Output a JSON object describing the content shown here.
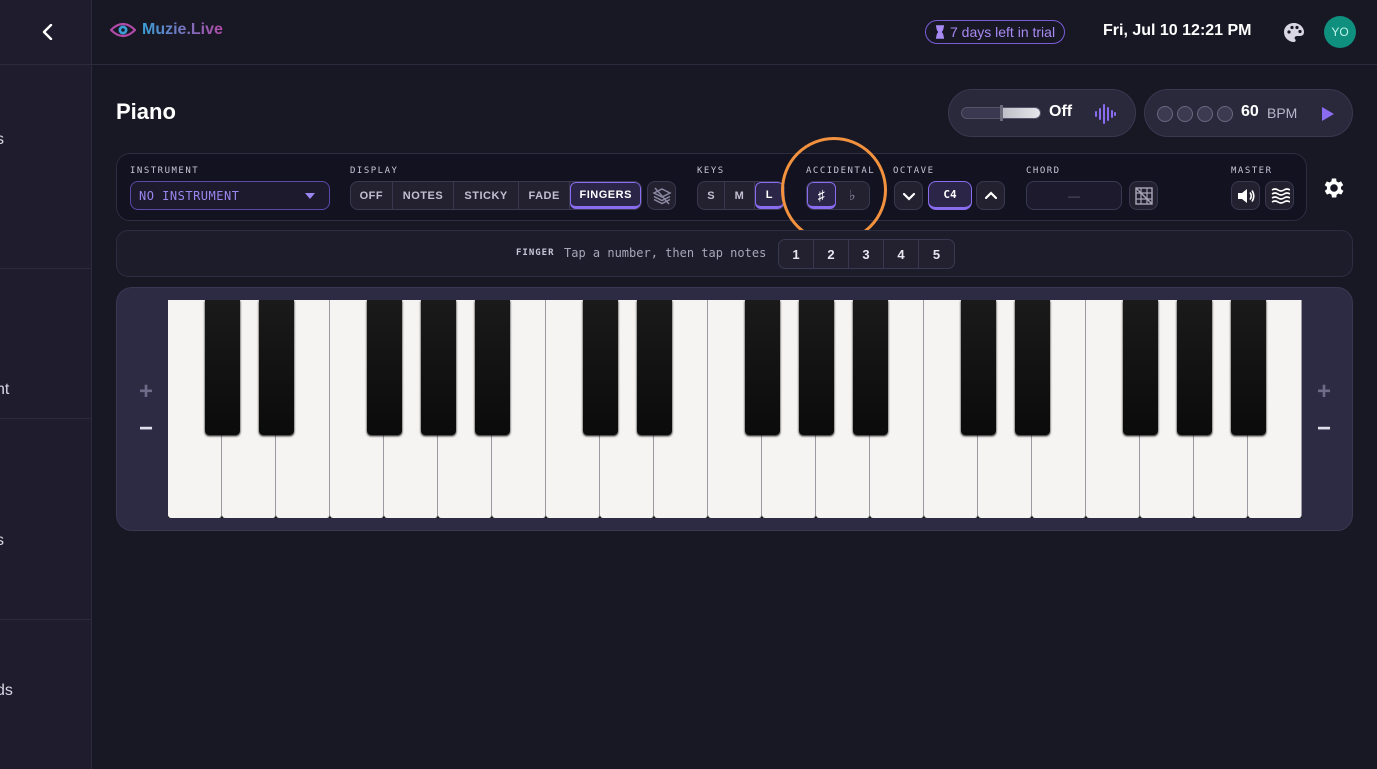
{
  "sidebar": {
    "items": [
      {
        "label": "s"
      },
      {
        "label": "nt"
      },
      {
        "label": "s"
      },
      {
        "label": "ds"
      }
    ]
  },
  "header": {
    "logo_text": "Muzie.Live",
    "trial_text": "7 days left in trial",
    "datetime": "Fri, Jul 10 12:21 PM",
    "avatar_initials": "YO"
  },
  "page": {
    "title": "Piano"
  },
  "mic": {
    "label": "Off",
    "level": 0.5
  },
  "metronome": {
    "bpm": "60",
    "unit": "BPM",
    "beats": 4
  },
  "controls": {
    "instrument": {
      "label": "INSTRUMENT",
      "value": "NO INSTRUMENT"
    },
    "display": {
      "label": "DISPLAY",
      "options": [
        "OFF",
        "NOTES",
        "STICKY",
        "FADE",
        "FINGERS"
      ],
      "selected": "FINGERS"
    },
    "keys": {
      "label": "KEYS",
      "options": [
        "S",
        "M",
        "L"
      ],
      "selected": "L"
    },
    "accidental": {
      "label": "ACCIDENTAL",
      "options": [
        "♯",
        "♭"
      ],
      "selected": "♯"
    },
    "octave": {
      "label": "OCTAVE",
      "value": "C4"
    },
    "chord": {
      "label": "CHORD",
      "value": "—"
    },
    "master": {
      "label": "MASTER"
    }
  },
  "finger": {
    "label": "FINGER",
    "hint": "Tap a number, then tap notes",
    "numbers": [
      "1",
      "2",
      "3",
      "4",
      "5"
    ]
  },
  "piano": {
    "zoom_in": "+",
    "zoom_out": "−",
    "white_keys": 21,
    "start_note": "C",
    "colors": {
      "accent": "#8a6cf0",
      "highlight": "#f2923e"
    }
  }
}
